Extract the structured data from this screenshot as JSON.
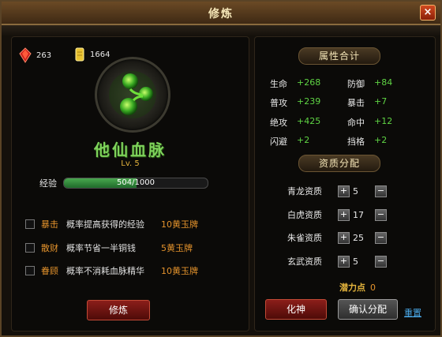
{
  "window": {
    "title": "修炼",
    "close_label": "×"
  },
  "resources": {
    "gems": "263",
    "gold": "1664"
  },
  "bloodline": {
    "name": "他仙血脉",
    "level": "Lv. 5",
    "exp_label": "经验",
    "exp_text": "504/1000",
    "exp_progress": 0.504
  },
  "options": [
    {
      "name": "暴击",
      "desc": "概率提高获得的经验",
      "cost": "10黄玉牌"
    },
    {
      "name": "散财",
      "desc": "概率节省一半铜钱",
      "cost": "5黄玉牌"
    },
    {
      "name": "眷顾",
      "desc": "概率不消耗血脉精华",
      "cost": "10黄玉牌"
    }
  ],
  "train_button": "修炼",
  "attributes": {
    "header": "属性合计",
    "items": [
      {
        "k": "生命",
        "v": "+268"
      },
      {
        "k": "防御",
        "v": "+84"
      },
      {
        "k": "普攻",
        "v": "+239"
      },
      {
        "k": "暴击",
        "v": "+7"
      },
      {
        "k": "绝攻",
        "v": "+425"
      },
      {
        "k": "命中",
        "v": "+12"
      },
      {
        "k": "闪避",
        "v": "+2"
      },
      {
        "k": "挡格",
        "v": "+2"
      }
    ]
  },
  "aptitude": {
    "header": "资质分配",
    "items": [
      {
        "k": "青龙资质",
        "v": "5"
      },
      {
        "k": "白虎资质",
        "v": "17"
      },
      {
        "k": "朱雀资质",
        "v": "25"
      },
      {
        "k": "玄武资质",
        "v": "5"
      }
    ],
    "plus": "+",
    "minus": "−",
    "potential_label": "潜力点",
    "potential_value": "0"
  },
  "buttons": {
    "transform": "化神",
    "confirm": "确认分配",
    "reset": "重置"
  },
  "colors": {
    "accent_green": "#5fd444",
    "orange": "#e3922c",
    "gold": "#e3b33c",
    "link": "#4aa8e8"
  }
}
